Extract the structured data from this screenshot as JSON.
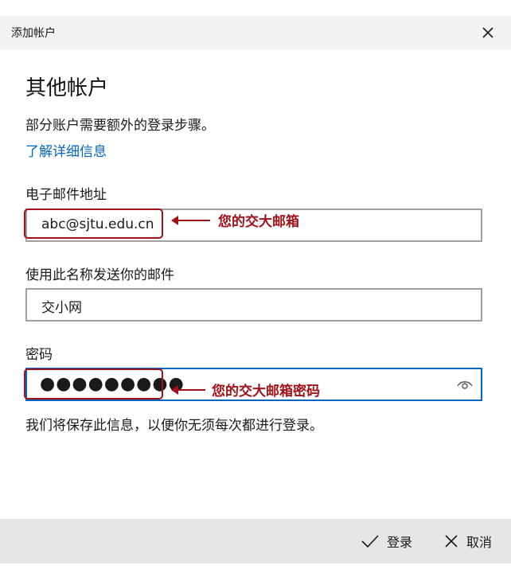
{
  "window": {
    "title": "添加帐户"
  },
  "page": {
    "heading": "其他帐户",
    "subtitle": "部分账户需要额外的登录步骤。",
    "learn_more": "了解详细信息"
  },
  "email": {
    "label": "电子邮件地址",
    "value": "abc@sjtu.edu.cn"
  },
  "display_name": {
    "label": "使用此名称发送你的邮件",
    "value": "交小网"
  },
  "password": {
    "label": "密码",
    "masked": "●●●●●●●●●"
  },
  "annotations": {
    "email_note": "您的交大邮箱",
    "password_note": "您的交大邮箱密码",
    "color": "#a11118"
  },
  "note": "我们将保存此信息，以便你无须每次都进行登录。",
  "footer": {
    "login": "登录",
    "cancel": "取消"
  },
  "icons": {
    "close": "close-icon",
    "eye": "eye-icon",
    "check": "check-icon",
    "cancel": "x-icon"
  },
  "colors": {
    "accent": "#0067c0",
    "border": "#a0a0a0",
    "footer_bg": "#e6e6e6",
    "titlebar_bg": "#f2f2f2"
  }
}
